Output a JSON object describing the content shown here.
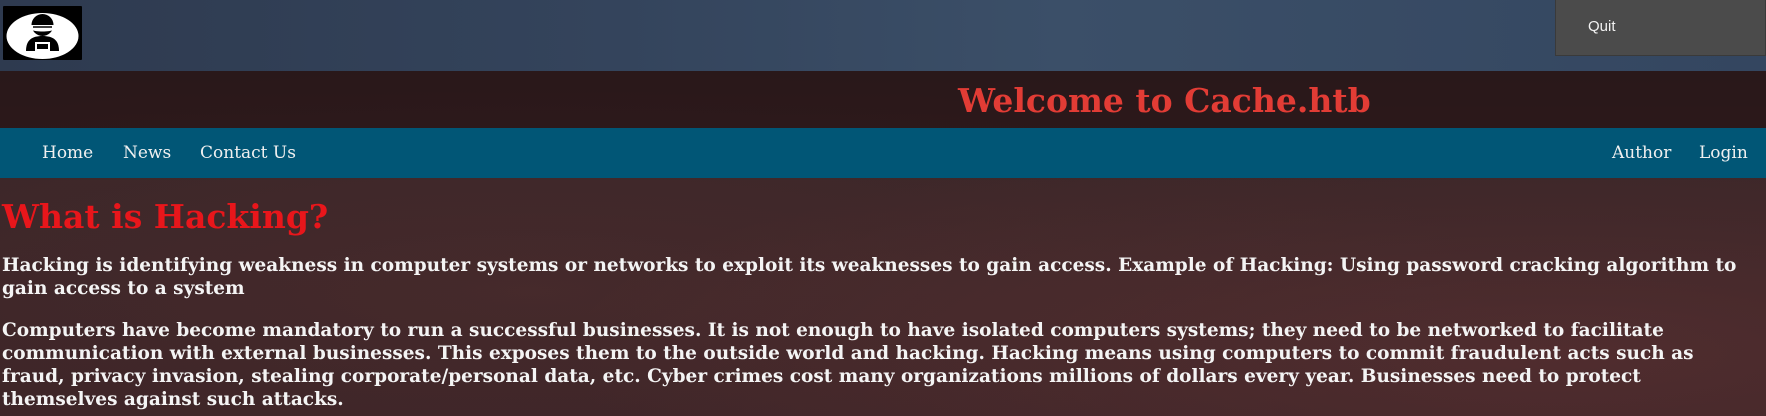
{
  "header": {
    "logo_icon": "hacker-logo-icon",
    "quit_label": "Quit"
  },
  "banner": {
    "title": "Welcome to Cache.htb"
  },
  "nav": {
    "left": [
      {
        "label": "Home"
      },
      {
        "label": "News"
      },
      {
        "label": "Contact Us"
      }
    ],
    "right": [
      {
        "label": "Author"
      },
      {
        "label": "Login"
      }
    ]
  },
  "main": {
    "heading": "What is Hacking?",
    "paragraphs": [
      "Hacking is identifying weakness in computer systems or networks to exploit its weaknesses to gain access. Example of Hacking: Using password cracking algorithm to gain access to a system",
      "Computers have become mandatory to run a successful businesses. It is not enough to have isolated computers systems; they need to be networked to facilitate communication with external businesses. This exposes them to the outside world and hacking. Hacking means using computers to commit fraudulent acts such as fraud, privacy invasion, stealing corporate/personal data, etc. Cyber crimes cost many organizations millions of dollars every year. Businesses need to protect themselves against such attacks."
    ]
  },
  "colors": {
    "title_red": "#e23c35",
    "heading_red": "#e8161b",
    "nav_blue": "#015676",
    "top_bar_blue": "#34445c"
  }
}
